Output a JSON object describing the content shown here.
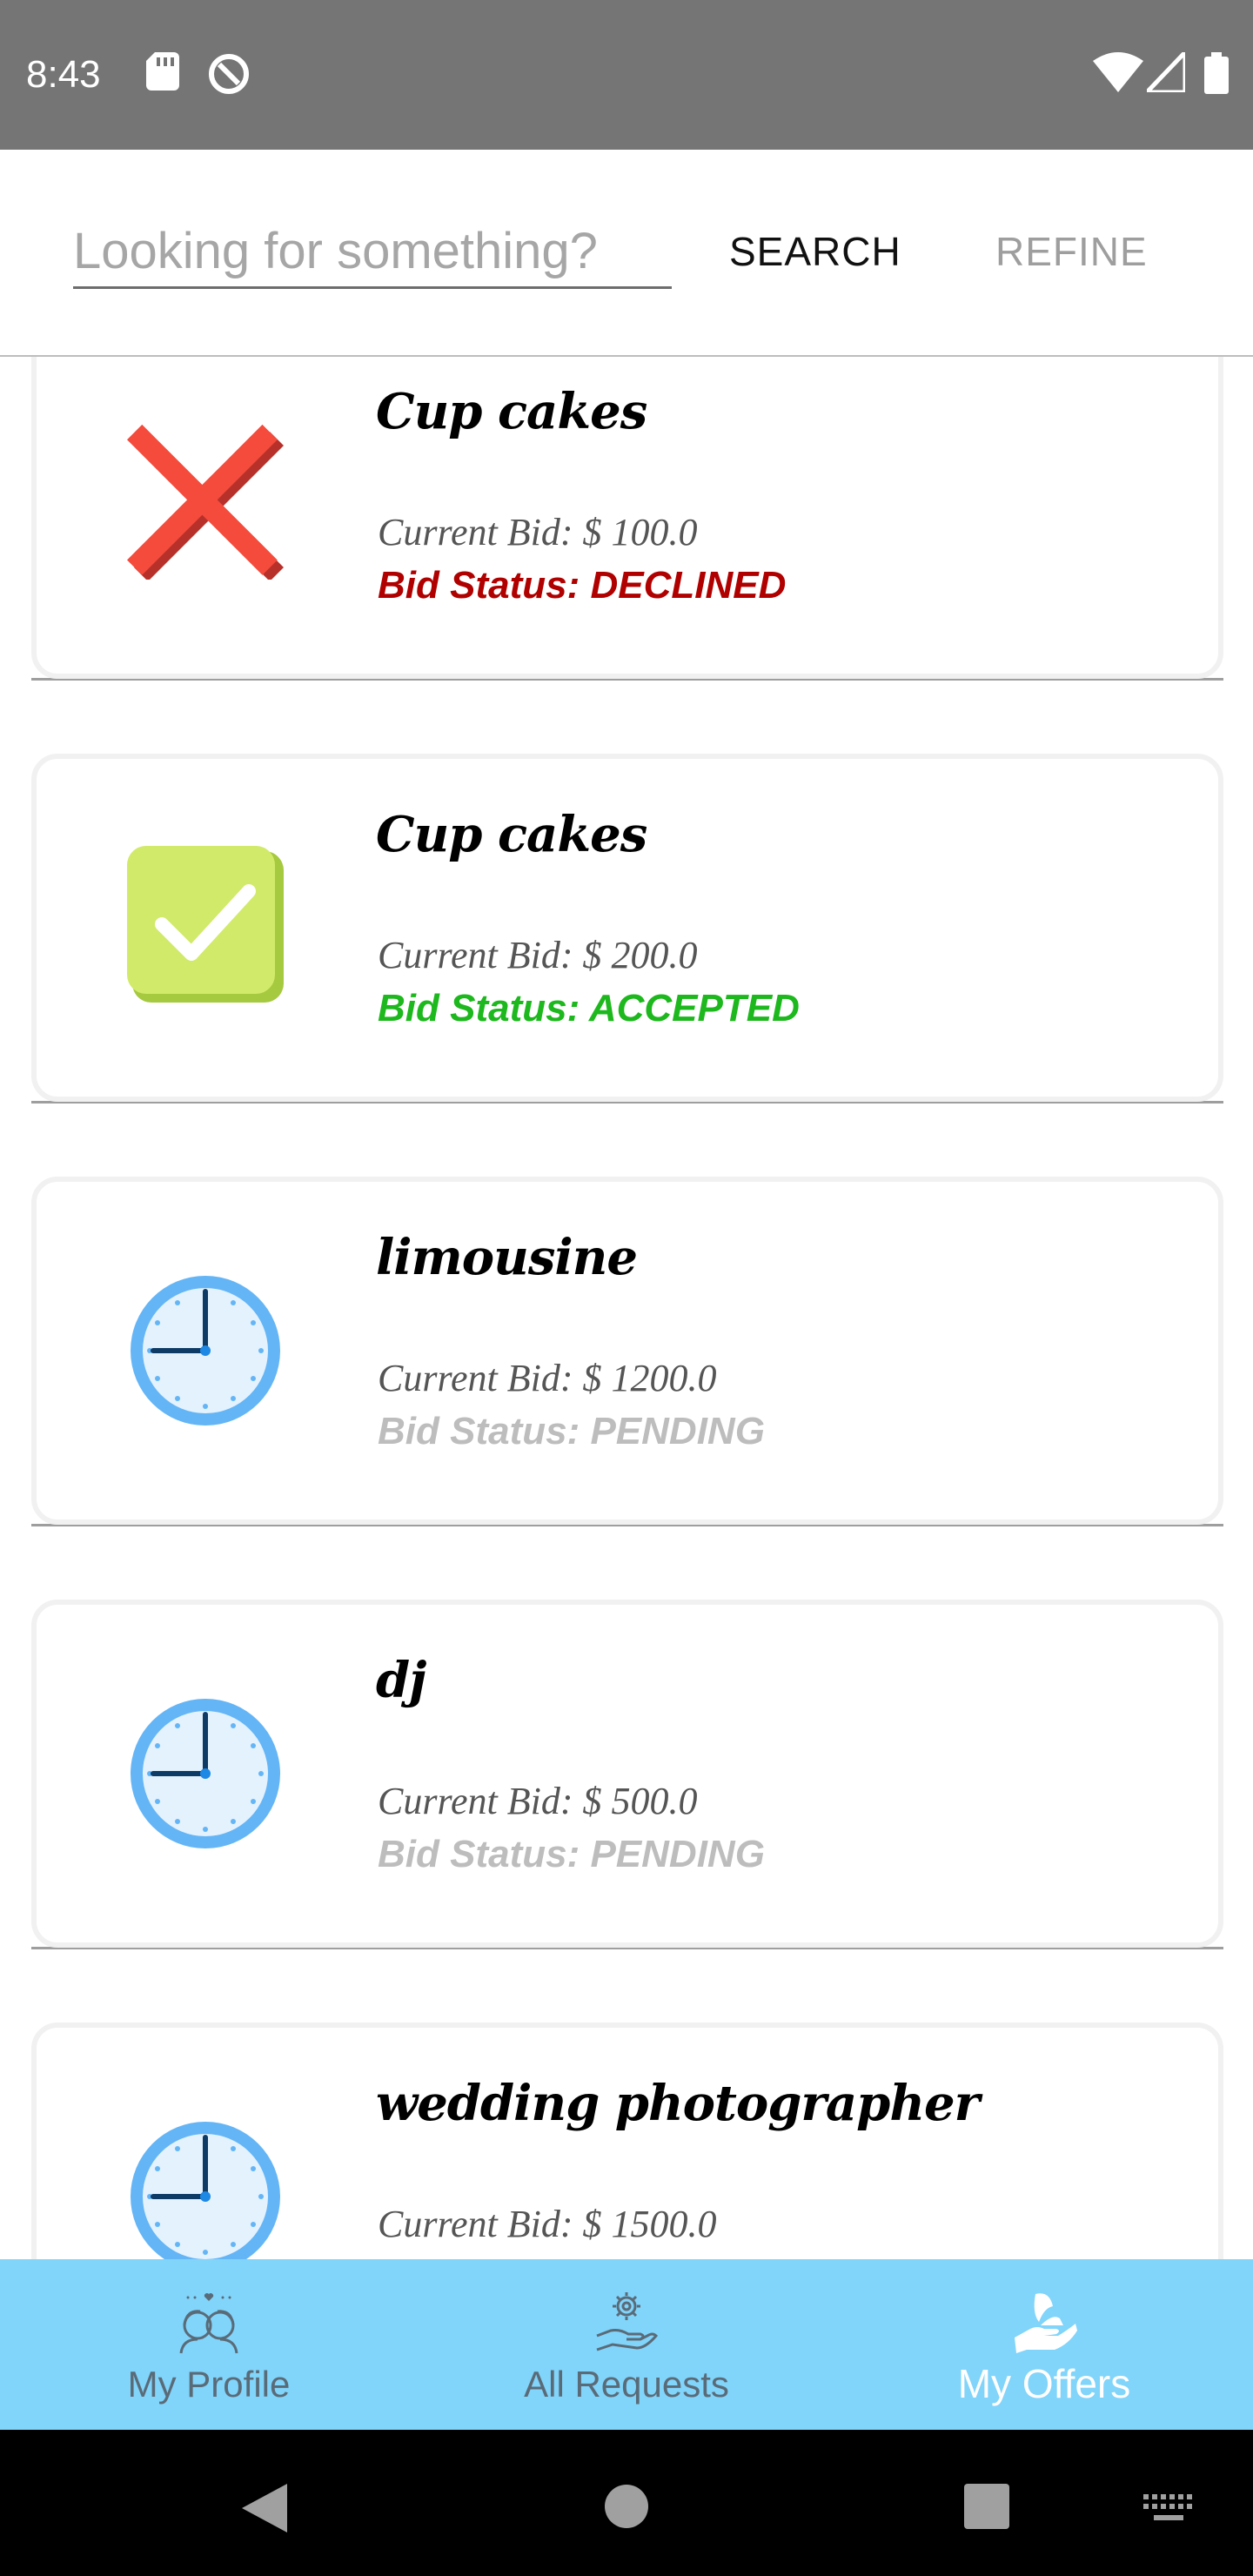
{
  "status_bar": {
    "time": "8:43",
    "icons": [
      "sd-card-icon",
      "no-disturb-icon",
      "wifi-icon",
      "signal-icon",
      "battery-icon"
    ]
  },
  "search": {
    "placeholder": "Looking for something?",
    "search_label": "SEARCH",
    "refine_label": "REFINE"
  },
  "offers": [
    {
      "title": "Cup cakes",
      "bid": "Current Bid: $ 100.0",
      "status": "Bid Status: DECLINED",
      "status_kind": "declined",
      "icon": "declined-x-icon"
    },
    {
      "title": "Cup cakes",
      "bid": "Current Bid: $ 200.0",
      "status": "Bid Status: ACCEPTED",
      "status_kind": "accepted",
      "icon": "accepted-check-icon"
    },
    {
      "title": "limousine",
      "bid": "Current Bid: $ 1200.0",
      "status": "Bid Status: PENDING",
      "status_kind": "pending",
      "icon": "pending-clock-icon"
    },
    {
      "title": "dj",
      "bid": "Current Bid: $ 500.0",
      "status": "Bid Status: PENDING",
      "status_kind": "pending",
      "icon": "pending-clock-icon"
    },
    {
      "title": "wedding photographer",
      "bid": "Current Bid: $ 1500.0",
      "status": "",
      "status_kind": "pending",
      "icon": "pending-clock-icon"
    }
  ],
  "status_colors": {
    "declined": "#b00000",
    "accepted": "#1db81d",
    "pending": "#bdbdbd"
  },
  "nav": {
    "items": [
      {
        "label": "My Profile",
        "icon": "couple-icon",
        "active": false
      },
      {
        "label": "All Requests",
        "icon": "gear-hand-icon",
        "active": false
      },
      {
        "label": "My Offers",
        "icon": "offer-hand-icon",
        "active": true
      }
    ],
    "background": "#81d4fa"
  },
  "system_nav": [
    "back-icon",
    "home-icon",
    "recents-icon",
    "keyboard-icon"
  ]
}
